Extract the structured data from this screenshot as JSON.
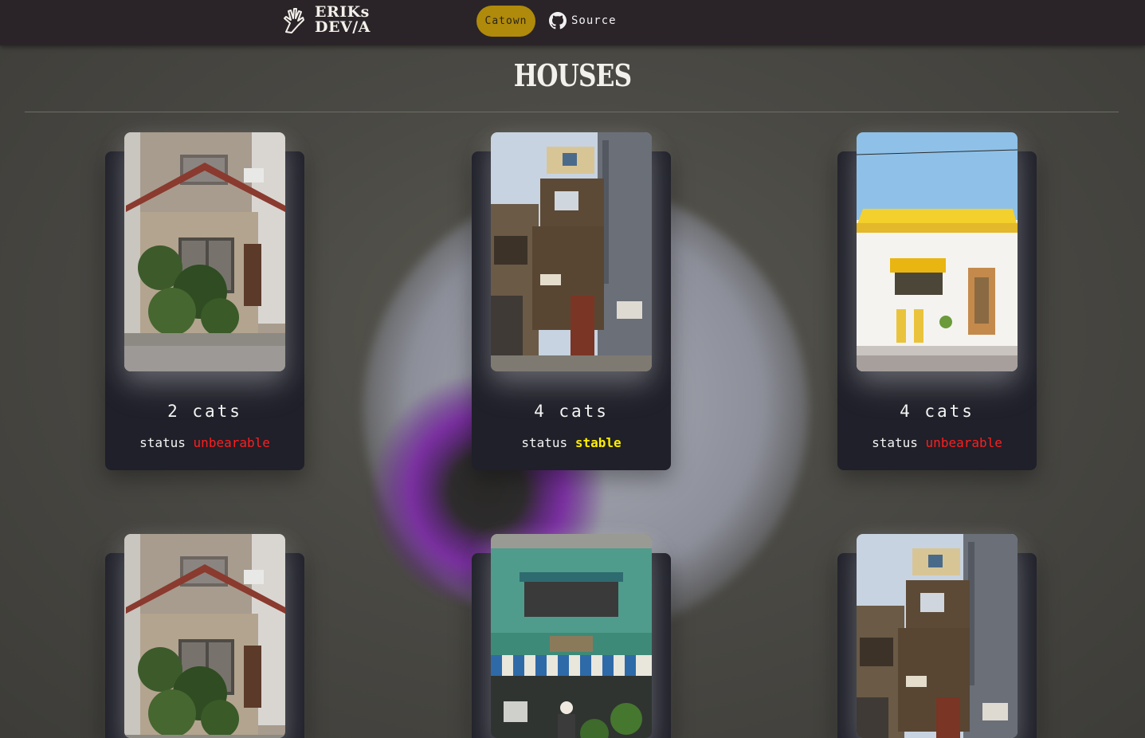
{
  "header": {
    "logo_line1": "ERIKs",
    "logo_line2": "DEV/A",
    "nav": [
      {
        "label": "Catown",
        "active": true
      },
      {
        "label": "Source",
        "icon": "github-icon"
      }
    ],
    "accent_color": "#b08a0a"
  },
  "page": {
    "title": "HOUSES"
  },
  "cards": [
    {
      "cats": "2 cats",
      "status_label": "status",
      "status_value": "unbearable",
      "status_color": "#ff1e1e",
      "image": "beige-two-story-house"
    },
    {
      "cats": "4 cats",
      "status_label": "status",
      "status_value": "stable",
      "status_color": "#ffee00",
      "image": "old-wooden-shack-house"
    },
    {
      "cats": "4 cats",
      "status_label": "status",
      "status_value": "unbearable",
      "status_color": "#ff1e1e",
      "image": "white-shop-yellow-roof"
    },
    {
      "image": "beige-two-story-house"
    },
    {
      "image": "green-shop-striped-awning"
    },
    {
      "image": "old-wooden-shack-house"
    }
  ]
}
